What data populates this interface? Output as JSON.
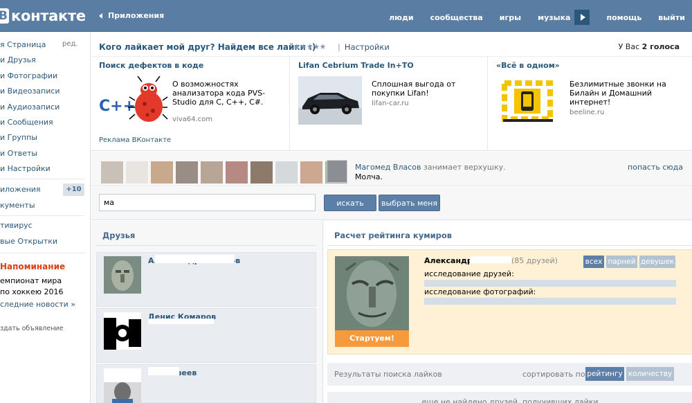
{
  "header": {
    "logo_letter": "В",
    "logo_text": "контакте",
    "breadcrumb": "Приложения",
    "nav": [
      "люди",
      "сообщества",
      "игры",
      "музыка",
      "помощь",
      "выйти"
    ]
  },
  "sidebar": {
    "items": [
      "я Страница",
      "и Друзья",
      "и Фотографии",
      "и Видеозаписи",
      "и Аудиозаписи",
      "и Сообщения",
      "и Группы",
      "и Ответы",
      "и Настройки"
    ],
    "edit_label": "ред.",
    "apps_label": "иложения",
    "apps_counter": "+10",
    "docs_label": "кументы",
    "extra_items": [
      "тивирус",
      "вые Открытки"
    ],
    "reminder_title": "Напоминание",
    "reminder_lines": [
      "емпионат мира",
      "по хоккею 2016"
    ],
    "reminder_link": "следние новости »",
    "create_ad": "здать объявление"
  },
  "app": {
    "title": "Кого лайкает мой друг? Найдем все лайки :)",
    "stars": "★★★★★",
    "settings_link": "Настройки",
    "votes_prefix": "У Вас",
    "votes_value": "2 голоса"
  },
  "ads": [
    {
      "title": "Поиск дефектов в коде",
      "text": "О возможностях анализатора кода PVS-Studio для C, C++, C#.",
      "domain": "viva64.com",
      "image_text": "C++"
    },
    {
      "title": "Lifan Cebrium Trade In+TO",
      "text": "Сплошная выгода от покупки Lifan!",
      "domain": "lifan-car.ru"
    },
    {
      "title": "«Всё в одном»",
      "text": "Безлимитные звонки на Билайн и Домашний интернет!",
      "domain": "beeline.ru"
    }
  ],
  "ads_footer": "Реклама ВКонтакте",
  "top": {
    "user": "Магомед Власов",
    "action": "занимает верхушку.",
    "status": "Молча.",
    "get_there": "попасть сюда"
  },
  "search": {
    "value": "ма",
    "search_label": "искать",
    "pick_me_label": "выбрать меня"
  },
  "friends": {
    "title": "Друзья",
    "items": [
      {
        "name": "А..........ндр Малатов"
      },
      {
        "name": "Денис Комаров"
      },
      {
        "name": "....Матвеев"
      }
    ]
  },
  "rating": {
    "title": "Расчет рейтинга кумиров",
    "name": "Александр ..........в",
    "friends_count": "(85 друзей)",
    "filters": [
      "всех",
      "парней",
      "девушек"
    ],
    "study_friends": "исследование друзей:",
    "study_photos": "исследование фотографий:",
    "start": "Стартуем!",
    "results_title": "Результаты поиска лайков",
    "sort_label": "сортировать по",
    "sort_options": [
      "рейтингу",
      "количеству"
    ],
    "empty_text": "еще не найдено друзей, получивших лайки"
  }
}
